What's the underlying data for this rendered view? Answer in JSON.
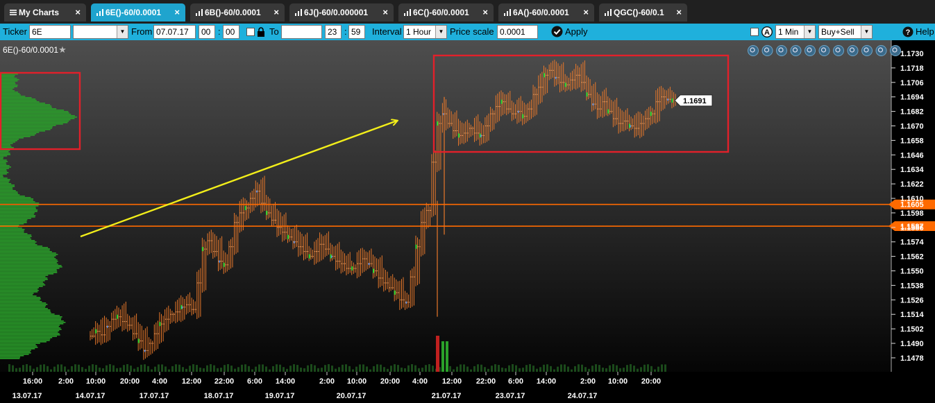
{
  "tabs": [
    {
      "label": "My Charts",
      "active": false
    },
    {
      "label": "6E()-60/0.0001",
      "active": true
    },
    {
      "label": "6B()-60/0.0001",
      "active": false
    },
    {
      "label": "6J()-60/0.000001",
      "active": false
    },
    {
      "label": "6C()-60/0.0001",
      "active": false
    },
    {
      "label": "6A()-60/0.0001",
      "active": false
    },
    {
      "label": "QGC()-60/0.1",
      "active": false
    }
  ],
  "toolbar": {
    "ticker_label": "Ticker",
    "ticker_value": "6E",
    "from_label": "From",
    "from_date": "07.07.17",
    "from_hour": "00",
    "from_min": "00",
    "to_label": "To",
    "to_date": "",
    "to_hour": "23",
    "to_min": "59",
    "interval_label": "Interval",
    "interval_value": "1 Hour",
    "price_scale_label": "Price scale",
    "price_scale_value": "0.0001",
    "apply_label": "Apply",
    "timeframe_value": "1 Min",
    "side_value": "Buy+Sell",
    "help_label": "Help"
  },
  "chart_title": "6E()-60/0.0001",
  "colors": {
    "tab_active": "#1fa4ce",
    "toolbar": "#1fb0dc",
    "bar": "#e8782a",
    "volume_profile": "#2aa12a",
    "level_line": "#ff6a00",
    "annotation_box": "#e2202a",
    "arrow": "#f2ee1a"
  },
  "chart_data": {
    "type": "bar",
    "price_axis_ticks": [
      "1.1730",
      "1.1718",
      "1.1706",
      "1.1694",
      "1.1682",
      "1.1670",
      "1.1658",
      "1.1646",
      "1.1634",
      "1.1622",
      "1.1610",
      "1.1598",
      "1.1586",
      "1.1574",
      "1.1562",
      "1.1550",
      "1.1538",
      "1.1526",
      "1.1514",
      "1.1502",
      "1.1490",
      "1.1478"
    ],
    "ylim": [
      1.147,
      1.1737
    ],
    "time_ticks": [
      {
        "time": "16:00",
        "date": "13.07.17"
      },
      {
        "time": "2:00",
        "date": ""
      },
      {
        "time": "10:00",
        "date": "14.07.17"
      },
      {
        "time": "20:00",
        "date": ""
      },
      {
        "time": "4:00",
        "date": "17.07.17"
      },
      {
        "time": "12:00",
        "date": ""
      },
      {
        "time": "22:00",
        "date": "18.07.17"
      },
      {
        "time": "6:00",
        "date": ""
      },
      {
        "time": "14:00",
        "date": "19.07.17"
      },
      {
        "time": "2:00",
        "date": ""
      },
      {
        "time": "10:00",
        "date": "20.07.17"
      },
      {
        "time": "20:00",
        "date": ""
      },
      {
        "time": "4:00",
        "date": ""
      },
      {
        "time": "12:00",
        "date": "21.07.17"
      },
      {
        "time": "22:00",
        "date": ""
      },
      {
        "time": "6:00",
        "date": "23.07.17"
      },
      {
        "time": "14:00",
        "date": ""
      },
      {
        "time": "2:00",
        "date": "24.07.17"
      },
      {
        "time": "10:00",
        "date": ""
      },
      {
        "time": "20:00",
        "date": ""
      }
    ],
    "levels": [
      {
        "price": 1.1605,
        "label": "1.1605"
      },
      {
        "price": 1.1587,
        "label": "1.1587"
      }
    ],
    "last_price": {
      "price": 1.1691,
      "label": "1.1691"
    },
    "close_path": [
      1.1496,
      1.15,
      1.1497,
      1.1504,
      1.151,
      1.1512,
      1.1508,
      1.1505,
      1.1498,
      1.1492,
      1.1484,
      1.149,
      1.1498,
      1.1506,
      1.151,
      1.1514,
      1.1516,
      1.152,
      1.1522,
      1.1518,
      1.154,
      1.1568,
      1.1575,
      1.1566,
      1.1558,
      1.1555,
      1.157,
      1.159,
      1.1598,
      1.1602,
      1.161,
      1.1616,
      1.1606,
      1.1598,
      1.1592,
      1.1586,
      1.1582,
      1.1578,
      1.1574,
      1.157,
      1.1566,
      1.1562,
      1.1566,
      1.1572,
      1.1568,
      1.1562,
      1.1558,
      1.1556,
      1.1552,
      1.1552,
      1.1556,
      1.156,
      1.1556,
      1.155,
      1.1544,
      1.154,
      1.1536,
      1.1532,
      1.1526,
      1.1524,
      1.1545,
      1.157,
      1.159,
      1.16,
      1.164,
      1.1672,
      1.168,
      1.1672,
      1.1666,
      1.1662,
      1.1664,
      1.1668,
      1.1664,
      1.1662,
      1.167,
      1.168,
      1.1686,
      1.169,
      1.1684,
      1.168,
      1.1682,
      1.1678,
      1.1684,
      1.1696,
      1.1702,
      1.1712,
      1.1716,
      1.171,
      1.1706,
      1.1704,
      1.1708,
      1.1712,
      1.1706,
      1.1696,
      1.1688,
      1.1684,
      1.169,
      1.1682,
      1.1676,
      1.1672,
      1.1674,
      1.167,
      1.1668,
      1.1672,
      1.1676,
      1.168,
      1.169,
      1.1694,
      1.1692,
      1.1691
    ]
  }
}
